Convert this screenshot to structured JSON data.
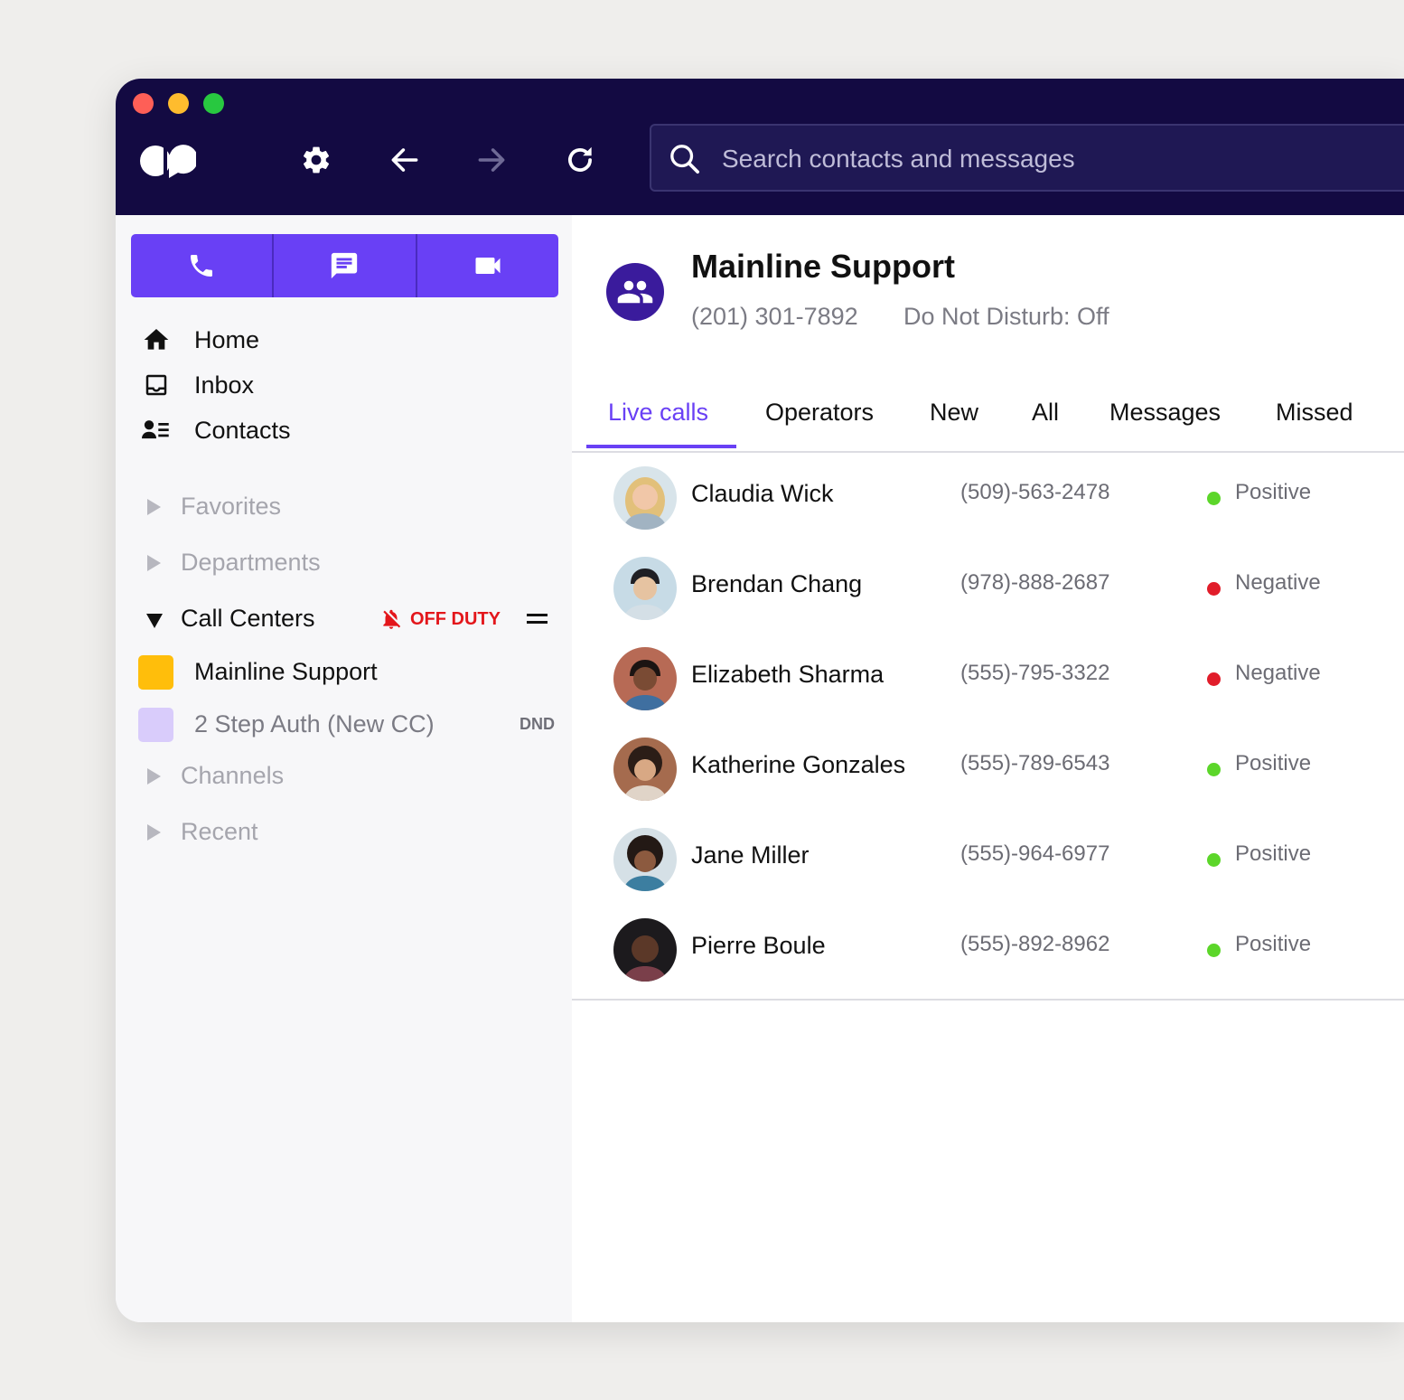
{
  "search": {
    "placeholder": "Search contacts and messages"
  },
  "toolbar": {
    "icons": [
      "logo",
      "gear-icon",
      "back-arrow-icon",
      "forward-arrow-icon",
      "refresh-icon",
      "search-icon"
    ]
  },
  "actions": {
    "icons": [
      "phone-icon",
      "message-icon",
      "video-icon"
    ],
    "color": "#6940f5"
  },
  "nav": {
    "items": [
      {
        "label": "Home",
        "icon": "home-icon"
      },
      {
        "label": "Inbox",
        "icon": "inbox-icon"
      },
      {
        "label": "Contacts",
        "icon": "contacts-icon"
      }
    ]
  },
  "sections": {
    "favorites": "Favorites",
    "departments": "Departments",
    "call_centers": "Call Centers",
    "off_duty": "OFF DUTY",
    "channels": "Channels",
    "recent": "Recent"
  },
  "call_centers": [
    {
      "label": "Mainline Support",
      "color": "#ffbe0b"
    },
    {
      "label": "2 Step Auth (New CC)",
      "color": "#d9ccfb",
      "badge": "DND"
    }
  ],
  "main": {
    "title": "Mainline Support",
    "phone": "(201) 301-7892",
    "dnd_status": "Do Not Disturb: Off",
    "tabs": [
      "Live calls",
      "Operators",
      "New",
      "All",
      "Messages",
      "Missed"
    ],
    "active_tab": "Live calls"
  },
  "calls": [
    {
      "name": "Claudia Wick",
      "phone": "(509)-563-2478",
      "sentiment": "Positive",
      "color": "#5cd62a"
    },
    {
      "name": "Brendan Chang",
      "phone": "(978)-888-2687",
      "sentiment": "Negative",
      "color": "#e11d2a"
    },
    {
      "name": "Elizabeth Sharma",
      "phone": "(555)-795-3322",
      "sentiment": "Negative",
      "color": "#e11d2a"
    },
    {
      "name": "Katherine Gonzales",
      "phone": "(555)-789-6543",
      "sentiment": "Positive",
      "color": "#5cd62a"
    },
    {
      "name": "Jane Miller",
      "phone": "(555)-964-6977",
      "sentiment": "Positive",
      "color": "#5cd62a"
    },
    {
      "name": "Pierre Boule",
      "phone": "(555)-892-8962",
      "sentiment": "Positive",
      "color": "#5cd62a"
    }
  ]
}
